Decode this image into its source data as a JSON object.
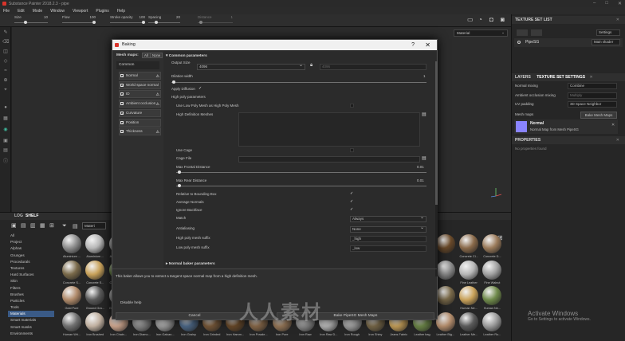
{
  "window": {
    "title": "Substance Painter 2018.2.3 - pipe"
  },
  "menu": [
    "File",
    "Edit",
    "Mode",
    "Window",
    "Viewport",
    "Plugins",
    "Help"
  ],
  "toolbar": {
    "size": {
      "label": "Size",
      "value": "10"
    },
    "flow": {
      "label": "Flow",
      "value": "100"
    },
    "stroke_opacity": {
      "label": "Stroke opacity",
      "value": "100"
    },
    "spacing": {
      "label": "Spacing",
      "value": "20"
    },
    "distance": {
      "label": "Distance",
      "value": "1"
    },
    "material_dropdown": "Material"
  },
  "texture_set_list": {
    "title": "TEXTURE SET LIST",
    "settings_label": "Settings",
    "item_name": "PipeSG",
    "shader": "Main shader"
  },
  "texture_set_settings": {
    "tab_layers": "LAYERS",
    "tab_settings": "TEXTURE SET SETTINGS",
    "normal_mixing_label": "Normal mixing",
    "normal_mixing_value": "Combine",
    "ao_mixing_label": "Ambient occlusion mixing",
    "ao_mixing_value": "Multiply",
    "uv_padding_label": "UV padding",
    "uv_padding_value": "3D Space Neighbor",
    "mesh_maps_label": "Mesh maps",
    "bake_button": "Bake Mesh Maps",
    "normal_map_title": "Normal",
    "normal_map_sub": "Normal Map from Mesh PipeSG"
  },
  "properties": {
    "title": "PROPERTIES",
    "empty": "No properties found"
  },
  "shelf": {
    "tab_log": "LOG",
    "tab_shelf": "SHELF",
    "search_value": "Materi",
    "categories": [
      "All",
      "Project",
      "Alphas",
      "Grunges",
      "Procedurals",
      "Textures",
      "Hard Surfaces",
      "Skin",
      "Filters",
      "Brushes",
      "Particles",
      "Tools",
      "Materials",
      "Smart materials",
      "Smart masks",
      "Environments"
    ],
    "selected_category": "Materials",
    "materials_row1": [
      "Aluminium ...",
      "Aluminium ...",
      "Aluminium ...",
      "",
      "",
      "",
      "",
      "",
      "",
      "",
      "",
      "",
      "",
      "",
      "",
      "",
      "",
      "Concrete Cl...",
      "Concrete D..."
    ],
    "materials_row2": [
      "Concrete S...",
      "Concrete S...",
      "Concrete S...",
      "",
      "",
      "",
      "",
      "",
      "",
      "",
      "",
      "",
      "",
      "",
      "",
      "",
      "",
      "Fine Leather",
      "Fine Walnut"
    ],
    "materials_row3": [
      "Gold Pure",
      "Ground Gra...",
      "Ground Gra...",
      "",
      "",
      "",
      "",
      "",
      "",
      "",
      "",
      "",
      "",
      "",
      "",
      "",
      "",
      "Human Ne...",
      "Human Ne..."
    ],
    "materials_row4": [
      "Human Wri...",
      "Iron Brushed",
      "Iron Chain...",
      "Iron Diamo...",
      "Iron Galvan...",
      "Iron Grainy",
      "Iron Grinded",
      "Iron Hamm...",
      "Iron Powde...",
      "Iron Pure",
      "Iron Raw",
      "Iron Raw D...",
      "Iron Rough",
      "Iron Shiny",
      "Jeans Fabric",
      "Leather bag",
      "Leather Big...",
      "Leather Me...",
      "Leather Ro..."
    ]
  },
  "dialog": {
    "title": "Baking",
    "mesh_maps_label": "Mesh maps:",
    "all_btn": "All",
    "none_btn": "None",
    "common_label": "Common",
    "maps": [
      {
        "label": "Normal",
        "warn": true
      },
      {
        "label": "World space normal",
        "warn": false
      },
      {
        "label": "ID",
        "warn": true
      },
      {
        "label": "Ambient occlusion",
        "warn": true
      },
      {
        "label": "Curvature",
        "warn": false
      },
      {
        "label": "Position",
        "warn": false
      },
      {
        "label": "Thickness",
        "warn": true
      }
    ],
    "common_params": "Common parameters",
    "output_size_label": "Output Size",
    "output_size_value": "4096",
    "output_size_value2": "4096",
    "dilation_label": "Dilation width",
    "dilation_value": "1",
    "apply_diffusion_label": "Apply Diffusion",
    "high_poly_params": "High poly parameters",
    "use_low_poly_label": "Use Low Poly Mesh as High Poly Mesh",
    "hd_meshes_label": "High Definition Meshes",
    "use_cage_label": "Use Cage",
    "cage_file_label": "Cage File",
    "max_frontal_label": "Max Frontal Distance",
    "max_frontal_value": "0.01",
    "max_rear_label": "Max Rear Distance",
    "max_rear_value": "0.01",
    "relative_bbox_label": "Relative to Bounding Box",
    "average_normals_label": "Average Normals",
    "ignore_backface_label": "Ignore Backface",
    "match_label": "Match",
    "match_value": "Always",
    "antialiasing_label": "Antialiasing",
    "antialiasing_value": "None",
    "hp_suffix_label": "High poly mesh suffix",
    "hp_suffix_value": "_high",
    "lp_suffix_label": "Low poly mesh suffix",
    "lp_suffix_value": "_low",
    "normal_baker_params": "Normal baker parameters",
    "description": "This baker allows you to extract a tangent space normal map from a high definition mesh.",
    "disable_help": "Disable help",
    "cancel_btn": "Cancel",
    "bake_btn": "Bake PipeSG Mesh Maps"
  },
  "overlay": {
    "watermark": "人人素材",
    "activate_title": "Activate Windows",
    "activate_sub": "Go to Settings to activate Windows."
  },
  "colors": {
    "accent": "#3a5a86",
    "brand": "#d9342b"
  }
}
